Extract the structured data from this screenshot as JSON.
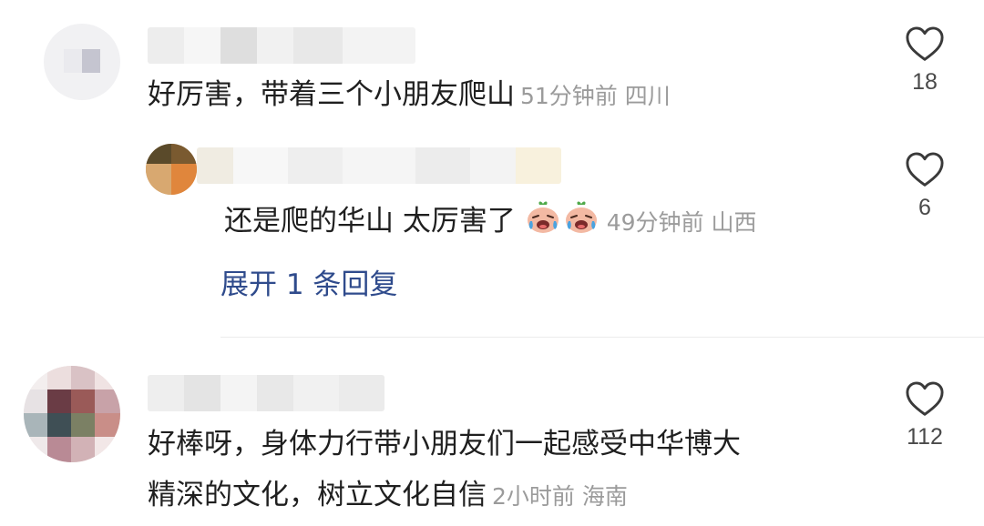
{
  "comments": [
    {
      "text": "好厉害，带着三个小朋友爬山",
      "meta": "51分钟前 四川",
      "likes": "18"
    },
    {
      "text": "还是爬的华山 太厉害了",
      "meta": "49分钟前 山西",
      "likes": "6"
    },
    {
      "text_line1": "好棒呀，身体力行带小朋友们一起感受中华博大",
      "text_line2": "精深的文化，树立文化自信",
      "meta": "2小时前 海南",
      "likes": "112"
    }
  ],
  "expand_label": "展开 1 条回复",
  "icons": {
    "like": "heart-outline-icon",
    "emoji": "crying-laughing-peach-emoji"
  },
  "colors": {
    "link": "#2f4b8c",
    "meta": "#9b9b9b"
  }
}
